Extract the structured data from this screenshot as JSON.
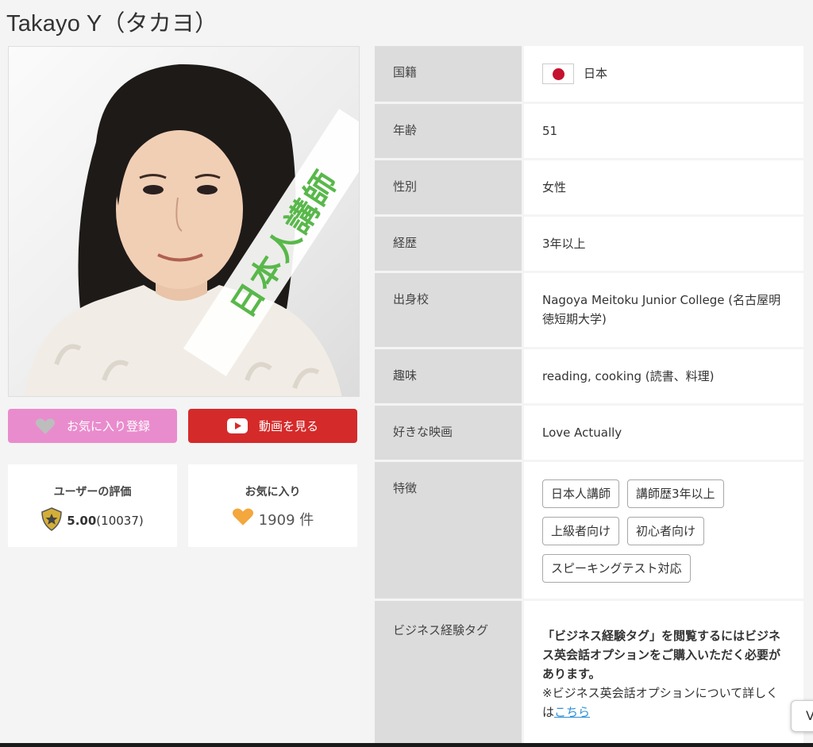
{
  "profile": {
    "name": "Takayo Y（タカヨ）",
    "ribbon": "日本人講師"
  },
  "buttons": {
    "favorite_label": "お気に入り登録",
    "video_label": "動画を見る"
  },
  "stats": {
    "rating_title": "ユーザーの評価",
    "rating_score": "5.00",
    "rating_count": "(10037)",
    "favorites_title": "お気に入り",
    "favorites_count": "1909 件"
  },
  "details": {
    "nationality": {
      "label": "国籍",
      "value": "日本"
    },
    "age": {
      "label": "年齢",
      "value": "51"
    },
    "gender": {
      "label": "性別",
      "value": "女性"
    },
    "experience": {
      "label": "経歴",
      "value": "3年以上"
    },
    "school": {
      "label": "出身校",
      "value": "Nagoya Meitoku Junior College (名古屋明徳短期大学)"
    },
    "hobby": {
      "label": "趣味",
      "value": "reading, cooking (読書、料理)"
    },
    "movie": {
      "label": "好きな映画",
      "value": "Love Actually"
    },
    "features": {
      "label": "特徴",
      "tags": [
        "日本人講師",
        "講師歴3年以上",
        "上級者向け",
        "初心者向け",
        "スピーキングテスト対応"
      ]
    },
    "business": {
      "label": "ビジネス経験タグ",
      "notice": "「ビジネス経験タグ」を閲覧するにはビジネス英会話オプションをご購入いただく必要があります。",
      "note_prefix": "※ビジネス英会話オプションについて詳しくは",
      "link": "こちら"
    }
  },
  "floating": {
    "label": "V"
  },
  "colors": {
    "favorite_button": "#e98ccd",
    "video_button": "#d52a2a",
    "ribbon_text": "#58b84a",
    "label_bg": "#dcdcdc",
    "link": "#2e8fd6"
  },
  "icons": [
    "heart-icon",
    "play-icon",
    "shield-star-icon",
    "orange-heart-icon",
    "japan-flag-icon"
  ]
}
